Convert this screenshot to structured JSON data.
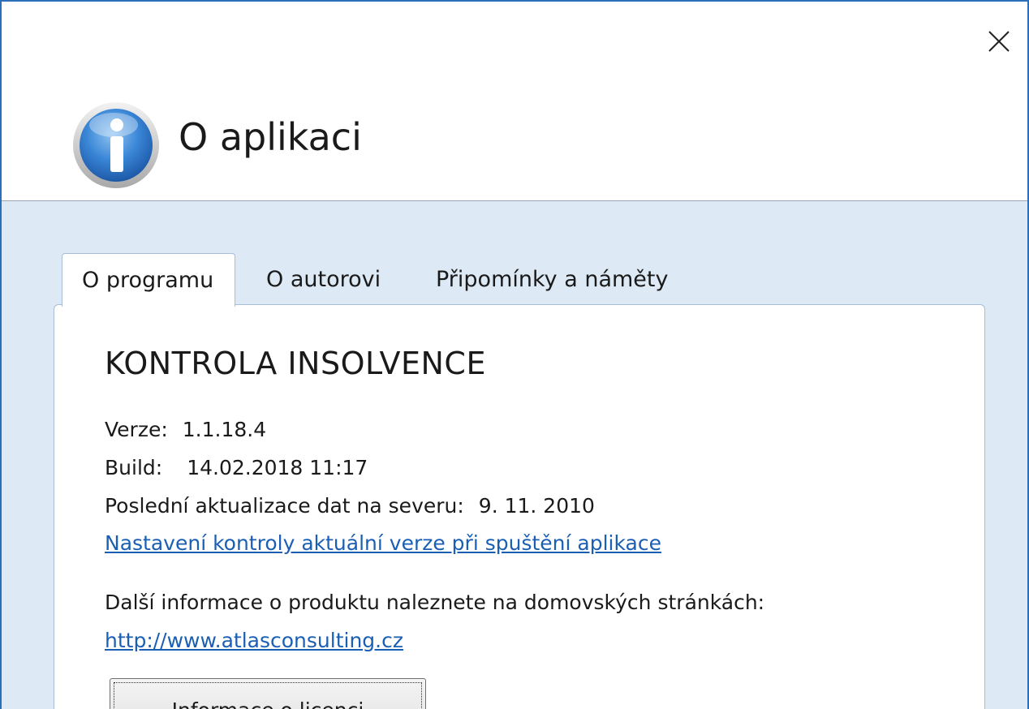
{
  "window": {
    "title": "O aplikaci",
    "close_icon": "close-icon",
    "title_icon": "info-icon"
  },
  "tabs": [
    {
      "label": "O programu",
      "active": true
    },
    {
      "label": "O autorovi",
      "active": false
    },
    {
      "label": "Připomínky a náměty",
      "active": false
    }
  ],
  "about": {
    "product_name": "KONTROLA INSOLVENCE",
    "version_label": "Verze:",
    "version_value": "1.1.18.4",
    "build_label": "Build:",
    "build_value": "14.02.2018 11:17",
    "update_label": "Poslední aktualizace dat na severu:",
    "update_value": "9. 11. 2010",
    "check_version_link": "Nastavení kontroly aktuální verze při spuštění aplikace",
    "more_info_text": "Další informace o produktu naleznete na domovských stránkách:",
    "website_link": "http://www.atlasconsulting.cz",
    "license_button": "Informace o licenci"
  },
  "colors": {
    "window_border": "#2c6fb8",
    "body_background": "#dde9f5",
    "link": "#1a5fb4"
  }
}
